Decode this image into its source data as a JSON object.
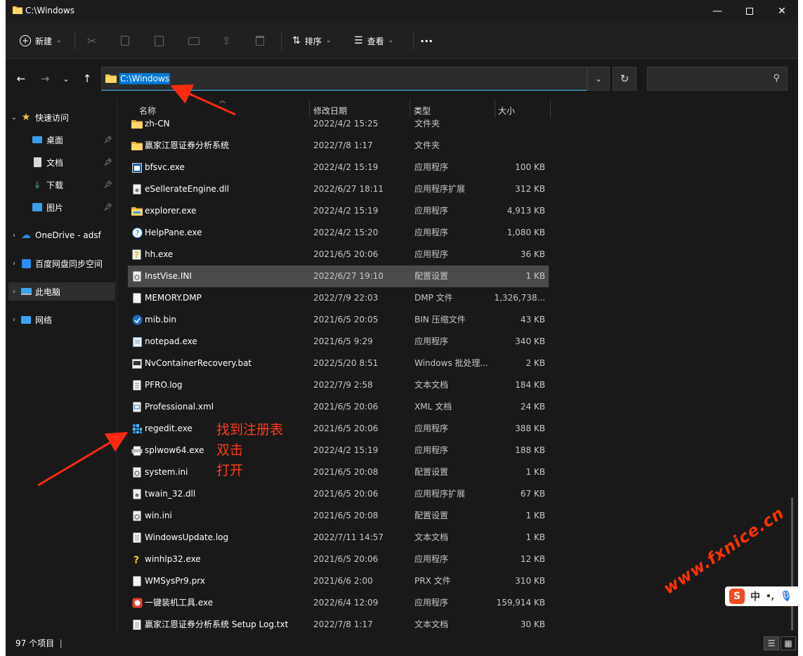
{
  "window": {
    "title": "C:\\Windows"
  },
  "toolbar": {
    "new_label": "新建",
    "sort_label": "排序",
    "view_label": "查看",
    "more_label": "···"
  },
  "address": {
    "path": "C:\\Windows",
    "search_placeholder": ""
  },
  "sidebar": {
    "quick_access": "快速访问",
    "items": [
      {
        "label": "桌面",
        "icon": "desktop-icon"
      },
      {
        "label": "文档",
        "icon": "documents-icon"
      },
      {
        "label": "下载",
        "icon": "downloads-icon"
      },
      {
        "label": "图片",
        "icon": "pictures-icon"
      }
    ],
    "onedrive": "OneDrive - adsf",
    "baidu": "百度网盘同步空间",
    "this_pc": "此电脑",
    "network": "网络"
  },
  "columns": {
    "name": "名称",
    "date": "修改日期",
    "type": "类型",
    "size": "大小"
  },
  "files": [
    {
      "name": "zh-CN",
      "date": "2022/4/2 15:25",
      "type": "文件夹",
      "size": "",
      "icon": "folder-icon"
    },
    {
      "name": "赢家江恩证券分析系统",
      "date": "2022/7/8 1:17",
      "type": "文件夹",
      "size": "",
      "icon": "folder-icon"
    },
    {
      "name": "bfsvc.exe",
      "date": "2022/4/2 15:19",
      "type": "应用程序",
      "size": "100 KB",
      "icon": "app-icon"
    },
    {
      "name": "eSellerateEngine.dll",
      "date": "2022/6/27 18:11",
      "type": "应用程序扩展",
      "size": "312 KB",
      "icon": "dll-icon"
    },
    {
      "name": "explorer.exe",
      "date": "2022/4/2 15:19",
      "type": "应用程序",
      "size": "4,913 KB",
      "icon": "explorer-icon"
    },
    {
      "name": "HelpPane.exe",
      "date": "2022/4/2 15:20",
      "type": "应用程序",
      "size": "1,080 KB",
      "icon": "help-icon"
    },
    {
      "name": "hh.exe",
      "date": "2021/6/5 20:06",
      "type": "应用程序",
      "size": "36 KB",
      "icon": "hh-icon"
    },
    {
      "name": "InstVise.INI",
      "date": "2022/6/27 19:10",
      "type": "配置设置",
      "size": "1 KB",
      "icon": "ini-icon"
    },
    {
      "name": "MEMORY.DMP",
      "date": "2022/7/9 22:03",
      "type": "DMP 文件",
      "size": "1,326,738...",
      "icon": "file-icon"
    },
    {
      "name": "mib.bin",
      "date": "2021/6/5 20:05",
      "type": "BIN 压缩文件",
      "size": "43 KB",
      "icon": "bin-icon"
    },
    {
      "name": "notepad.exe",
      "date": "2021/6/5 9:29",
      "type": "应用程序",
      "size": "340 KB",
      "icon": "notepad-icon"
    },
    {
      "name": "NvContainerRecovery.bat",
      "date": "2022/5/20 8:51",
      "type": "Windows 批处理...",
      "size": "2 KB",
      "icon": "bat-icon"
    },
    {
      "name": "PFRO.log",
      "date": "2022/7/9 2:58",
      "type": "文本文档",
      "size": "184 KB",
      "icon": "text-file-icon"
    },
    {
      "name": "Professional.xml",
      "date": "2021/6/5 20:06",
      "type": "XML 文档",
      "size": "24 KB",
      "icon": "xml-icon"
    },
    {
      "name": "regedit.exe",
      "date": "2021/6/5 20:06",
      "type": "应用程序",
      "size": "388 KB",
      "icon": "regedit-icon"
    },
    {
      "name": "splwow64.exe",
      "date": "2022/4/2 15:19",
      "type": "应用程序",
      "size": "188 KB",
      "icon": "printer-icon"
    },
    {
      "name": "system.ini",
      "date": "2021/6/5 20:08",
      "type": "配置设置",
      "size": "1 KB",
      "icon": "ini-icon"
    },
    {
      "name": "twain_32.dll",
      "date": "2021/6/5 20:06",
      "type": "应用程序扩展",
      "size": "67 KB",
      "icon": "dll-icon"
    },
    {
      "name": "win.ini",
      "date": "2021/6/5 20:08",
      "type": "配置设置",
      "size": "1 KB",
      "icon": "ini-icon"
    },
    {
      "name": "WindowsUpdate.log",
      "date": "2022/7/11 14:57",
      "type": "文本文档",
      "size": "1 KB",
      "icon": "text-file-icon"
    },
    {
      "name": "winhlp32.exe",
      "date": "2021/6/5 20:06",
      "type": "应用程序",
      "size": "12 KB",
      "icon": "winhlp-icon"
    },
    {
      "name": "WMSysPr9.prx",
      "date": "2021/6/6 2:00",
      "type": "PRX 文件",
      "size": "310 KB",
      "icon": "file-icon"
    },
    {
      "name": "一键装机工具.exe",
      "date": "2022/6/4 12:09",
      "type": "应用程序",
      "size": "159,914 KB",
      "icon": "installer-icon"
    },
    {
      "name": "赢家江恩证券分析系统 Setup Log.txt",
      "date": "2022/7/8 1:17",
      "type": "文本文档",
      "size": "30 KB",
      "icon": "text-file-icon"
    }
  ],
  "highlighted_row": 7,
  "status": {
    "count": "97 个项目",
    "cursor": "|"
  },
  "annotation": {
    "line1": "找到注册表",
    "line2": "双击",
    "line3": "打开"
  },
  "ime": {
    "logo": "S",
    "lang": "中",
    "punct": "•,",
    "mic": "mic-icon"
  },
  "watermark": "www.fxnice.cn",
  "colors": {
    "accent": "#0078d4",
    "annotation": "#ff3b1e",
    "window_bg": "#191919",
    "highlight_row": "#4a4a4a"
  }
}
